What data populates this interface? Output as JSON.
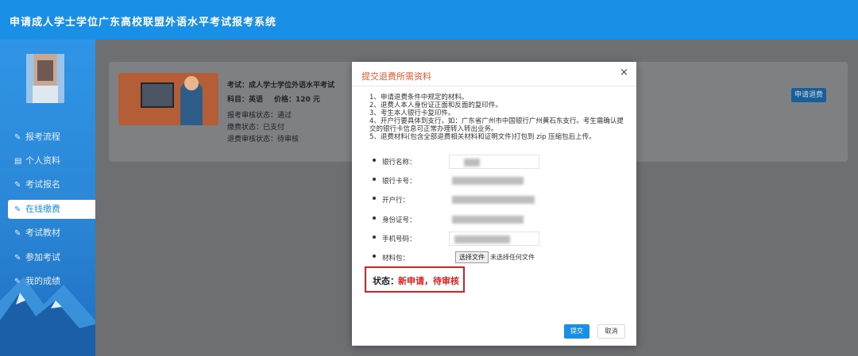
{
  "header": {
    "title": "申请成人学士学位广东高校联盟外语水平考试报考系统"
  },
  "sidebar": {
    "items": [
      {
        "label": "报考流程",
        "icon": "edit-icon"
      },
      {
        "label": "个人资料",
        "icon": "file-icon"
      },
      {
        "label": "考试报名",
        "icon": "edit-icon"
      },
      {
        "label": "在线缴费",
        "icon": "edit-icon",
        "active": true
      },
      {
        "label": "考试教材",
        "icon": "edit-icon"
      },
      {
        "label": "参加考试",
        "icon": "edit-icon"
      },
      {
        "label": "我的成绩",
        "icon": "edit-icon"
      }
    ]
  },
  "card": {
    "exam": "考试：成人学士学位外语水平考试",
    "subject": "科目：英语",
    "price": "价格：120 元",
    "review_status": "报考审核状态：通过",
    "pay_status": "缴费状态：已支付",
    "refund_status": "退费审核状态：待审核",
    "refund_button": "申请退费"
  },
  "modal": {
    "title": "提交退费所需资料",
    "close": "×",
    "rules": [
      "1、申请退费条件中规定的材料。",
      "2、退费人本人身份证正面和反面的复印件。",
      "3、考生本人银行卡复印件。",
      "4、开户行要具体到支行，如：广东省广州市中国银行广州黄石东支行。考生需确认提交的银行卡信息可正常办理转入转出业务。",
      "5、退费材料(包含全部退费相关材料和证明文件)打包到 zip 压缩包后上传。"
    ],
    "fields": [
      {
        "label": "银行名称："
      },
      {
        "label": "银行卡号："
      },
      {
        "label": "开户行："
      },
      {
        "label": "身份证号："
      },
      {
        "label": "手机号码："
      },
      {
        "label": "材料包："
      }
    ],
    "file_button": "选择文件",
    "file_text": "未选择任何文件",
    "status_label": "状态：",
    "status_value": "新申请，待审核",
    "submit": "提交",
    "cancel": "取消"
  },
  "colors": {
    "primary": "#1a8fe6",
    "danger": "#e02020",
    "title": "#e4572e"
  }
}
